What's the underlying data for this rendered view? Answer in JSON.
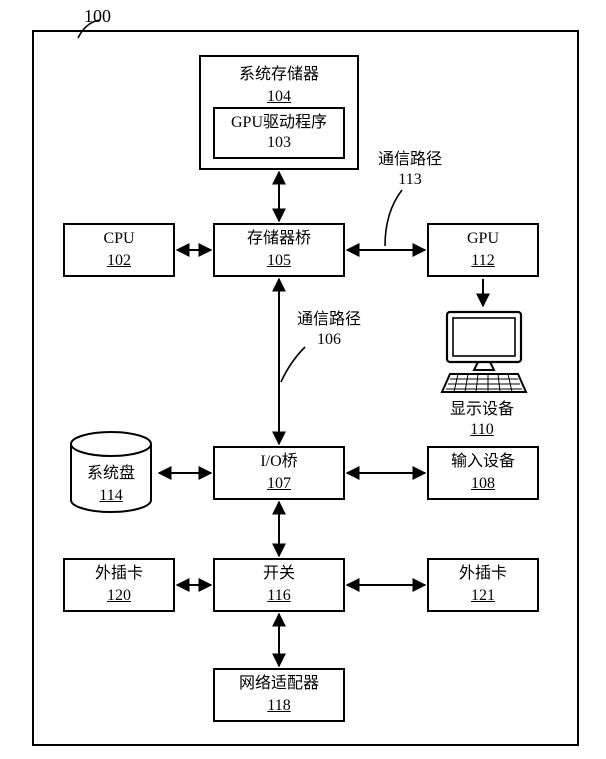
{
  "figure_ref": "100",
  "blocks": {
    "sys_mem": {
      "title": "系统存储器",
      "ref": "104"
    },
    "gpu_drv": {
      "title": "GPU驱动程序",
      "ref": "103"
    },
    "cpu": {
      "title": "CPU",
      "ref": "102"
    },
    "mem_bridge": {
      "title": "存储器桥",
      "ref": "105"
    },
    "gpu": {
      "title": "GPU",
      "ref": "112"
    },
    "io_bridge": {
      "title": "I/O桥",
      "ref": "107"
    },
    "input_dev": {
      "title": "输入设备",
      "ref": "108"
    },
    "switch": {
      "title": "开关",
      "ref": "116"
    },
    "addin_l": {
      "title": "外插卡",
      "ref": "120"
    },
    "addin_r": {
      "title": "外插卡",
      "ref": "121"
    },
    "net": {
      "title": "网络适配器",
      "ref": "118"
    },
    "sys_disk": {
      "title": "系统盘",
      "ref": "114"
    },
    "display": {
      "title": "显示设备",
      "ref": "110"
    }
  },
  "labels": {
    "comm113": {
      "title": "通信路径",
      "ref": "113"
    },
    "comm106": {
      "title": "通信路径",
      "ref": "106"
    }
  },
  "chart_data": {
    "type": "diagram",
    "title": "Computer system block diagram (Figure 100)",
    "nodes": [
      {
        "id": "102",
        "label": "CPU"
      },
      {
        "id": "103",
        "label": "GPU驱动程序"
      },
      {
        "id": "104",
        "label": "系统存储器",
        "contains": [
          "103"
        ]
      },
      {
        "id": "105",
        "label": "存储器桥"
      },
      {
        "id": "106",
        "label": "通信路径"
      },
      {
        "id": "107",
        "label": "I/O桥"
      },
      {
        "id": "108",
        "label": "输入设备"
      },
      {
        "id": "110",
        "label": "显示设备"
      },
      {
        "id": "112",
        "label": "GPU"
      },
      {
        "id": "113",
        "label": "通信路径"
      },
      {
        "id": "114",
        "label": "系统盘"
      },
      {
        "id": "116",
        "label": "开关"
      },
      {
        "id": "118",
        "label": "网络适配器"
      },
      {
        "id": "120",
        "label": "外插卡"
      },
      {
        "id": "121",
        "label": "外插卡"
      }
    ],
    "edges": [
      {
        "from": "104",
        "to": "105",
        "dir": "both"
      },
      {
        "from": "102",
        "to": "105",
        "dir": "both"
      },
      {
        "from": "105",
        "to": "112",
        "dir": "both",
        "via": "113"
      },
      {
        "from": "105",
        "to": "107",
        "dir": "both",
        "via": "106"
      },
      {
        "from": "112",
        "to": "110",
        "dir": "one"
      },
      {
        "from": "114",
        "to": "107",
        "dir": "both"
      },
      {
        "from": "107",
        "to": "108",
        "dir": "both"
      },
      {
        "from": "107",
        "to": "116",
        "dir": "both"
      },
      {
        "from": "120",
        "to": "116",
        "dir": "both"
      },
      {
        "from": "116",
        "to": "121",
        "dir": "both"
      },
      {
        "from": "116",
        "to": "118",
        "dir": "both"
      }
    ]
  }
}
